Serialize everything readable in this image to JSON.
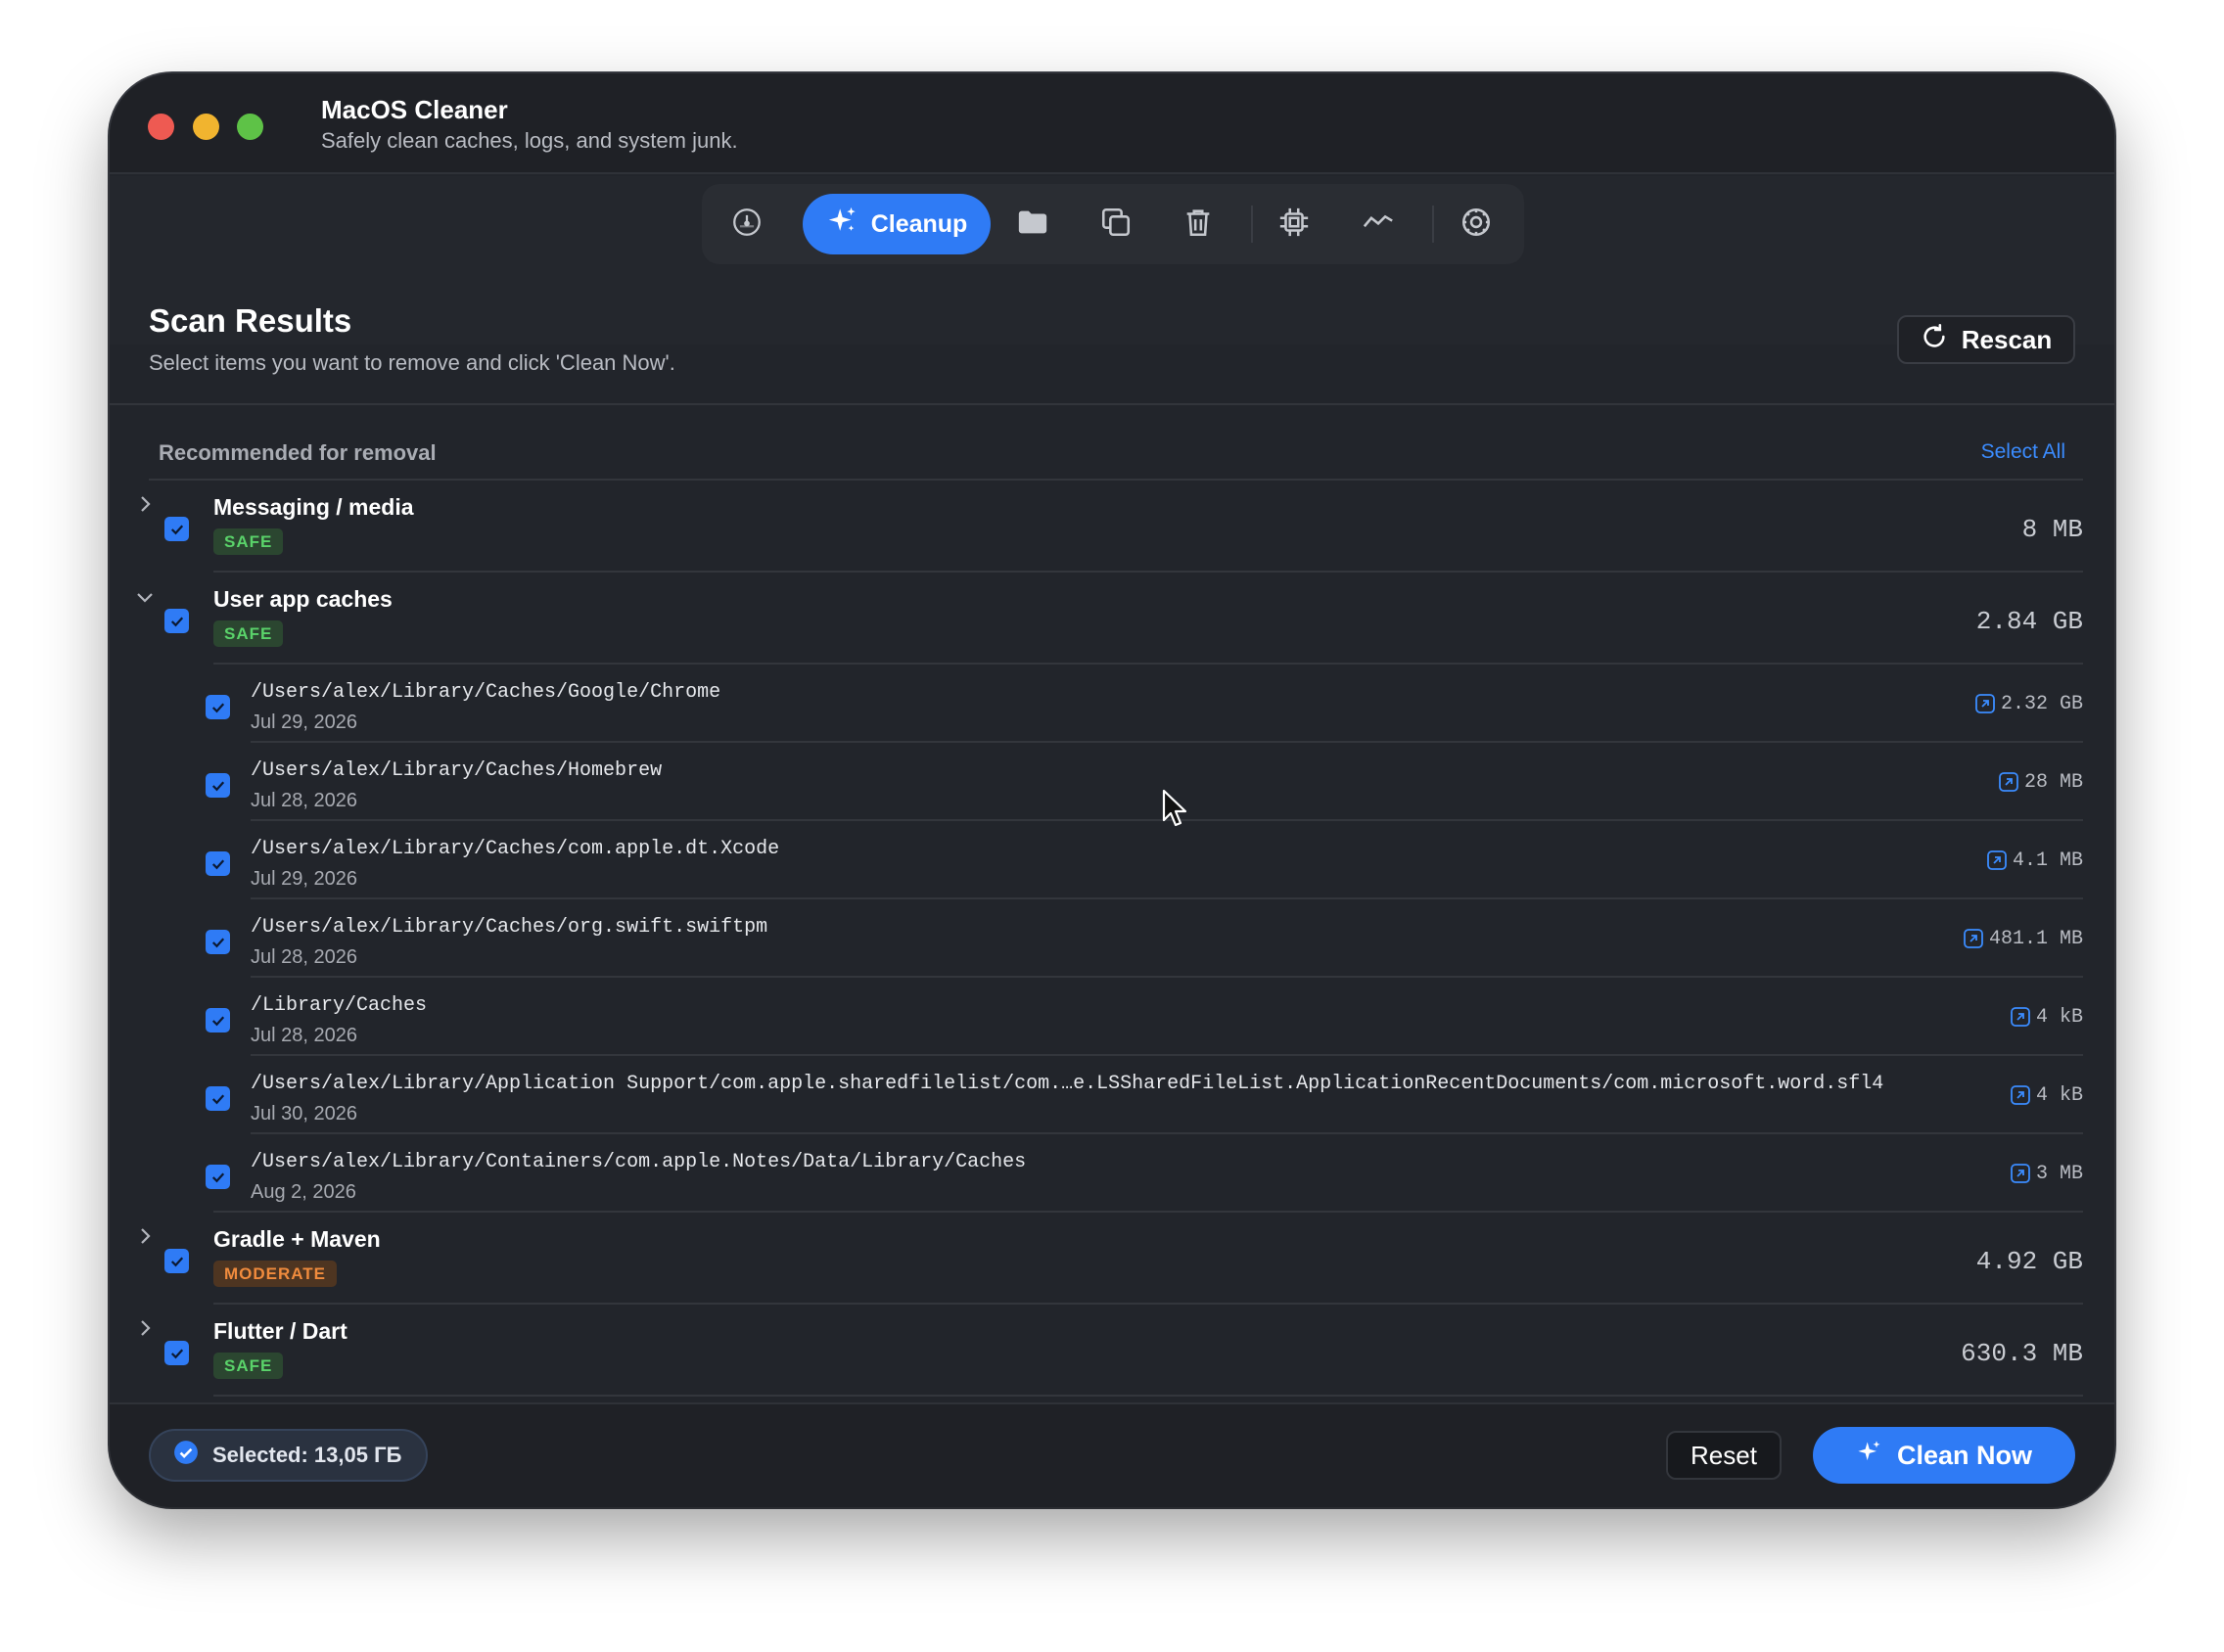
{
  "window": {
    "title": "MacOS Cleaner",
    "subtitle": "Safely clean caches, logs, and system junk."
  },
  "toolbar": {
    "active_label": "Cleanup",
    "icons": [
      "gauge-icon",
      "sparkles-icon",
      "folder-icon",
      "duplicate-icon",
      "trash-icon",
      "chip-icon",
      "activity-icon",
      "gear-icon"
    ]
  },
  "scan": {
    "title": "Scan Results",
    "subtitle": "Select items you want to remove and click 'Clean Now'.",
    "rescan_label": "Rescan"
  },
  "section": {
    "label": "Recommended for removal",
    "select_all": "Select All"
  },
  "groups": [
    {
      "name": "Messaging / media",
      "badge": "SAFE",
      "size": "8 MB",
      "expanded": false,
      "checked": true
    },
    {
      "name": "User app caches",
      "badge": "SAFE",
      "size": "2.84 GB",
      "expanded": true,
      "checked": true,
      "items": [
        {
          "path": "/Users/alex/Library/Caches/Google/Chrome",
          "date": "Jul 29, 2026",
          "size": "2.32 GB",
          "checked": true
        },
        {
          "path": "/Users/alex/Library/Caches/Homebrew",
          "date": "Jul 28, 2026",
          "size": "28 MB",
          "checked": true
        },
        {
          "path": "/Users/alex/Library/Caches/com.apple.dt.Xcode",
          "date": "Jul 29, 2026",
          "size": "4.1 MB",
          "checked": true
        },
        {
          "path": "/Users/alex/Library/Caches/org.swift.swiftpm",
          "date": "Jul 28, 2026",
          "size": "481.1 MB",
          "checked": true
        },
        {
          "path": "/Library/Caches",
          "date": "Jul 28, 2026",
          "size": "4 kB",
          "checked": true
        },
        {
          "path": "/Users/alex/Library/Application Support/com.apple.sharedfilelist/com.…e.LSSharedFileList.ApplicationRecentDocuments/com.microsoft.word.sfl4",
          "date": "Jul 30, 2026",
          "size": "4 kB",
          "checked": true
        },
        {
          "path": "/Users/alex/Library/Containers/com.apple.Notes/Data/Library/Caches",
          "date": "Aug 2, 2026",
          "size": "3 MB",
          "checked": true
        }
      ]
    },
    {
      "name": "Gradle + Maven",
      "badge": "MODERATE",
      "size": "4.92 GB",
      "expanded": false,
      "checked": true
    },
    {
      "name": "Flutter / Dart",
      "badge": "SAFE",
      "size": "630.3 MB",
      "expanded": false,
      "checked": true
    }
  ],
  "footer": {
    "selected": "Selected: 13,05 ГБ",
    "reset_label": "Reset",
    "clean_label": "Clean Now"
  },
  "colors": {
    "accent": "#2f7bf5",
    "safe": "#5ad36a",
    "moderate": "#f08b3d",
    "window_bg": "#22252b"
  }
}
